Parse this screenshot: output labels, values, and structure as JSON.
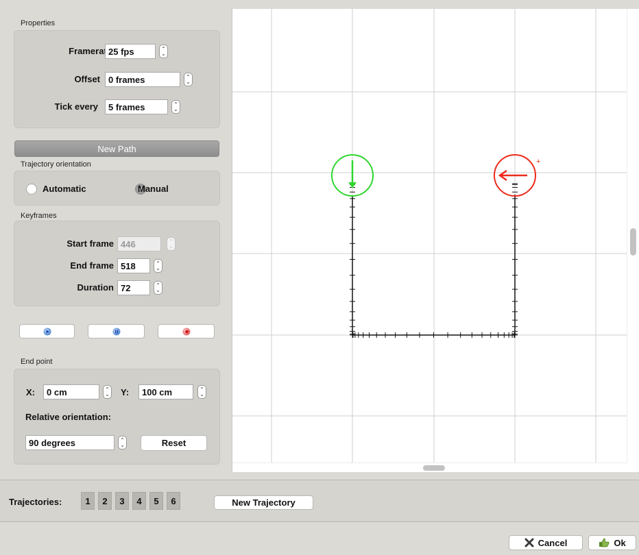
{
  "properties": {
    "title": "Properties",
    "framerate_label": "Framerate",
    "framerate_value": "25 fps",
    "offset_label": "Offset",
    "offset_value": "0 frames",
    "tick_label": "Tick every",
    "tick_value": "5 frames"
  },
  "new_path_label": "New Path",
  "orientation": {
    "title": "Trajectory orientation",
    "automatic_label": "Automatic",
    "manual_label": "Manual",
    "selected": "Manual"
  },
  "keyframes": {
    "title": "Keyframes",
    "start_label": "Start frame",
    "start_value": "446",
    "end_label": "End frame",
    "end_value": "518",
    "duration_label": "Duration",
    "duration_value": "72"
  },
  "endpoint": {
    "title": "End point",
    "x_label": "X:",
    "x_value": "0 cm",
    "y_label": "Y:",
    "y_value": "100 cm",
    "rel_label": "Relative orientation:",
    "rel_value": "90 degrees",
    "reset_label": "Reset"
  },
  "trajectories": {
    "label": "Trajectories:",
    "tabs": [
      "1",
      "2",
      "3",
      "4",
      "5",
      "6"
    ],
    "new_label": "New Trajectory"
  },
  "footer": {
    "cancel_label": "Cancel",
    "ok_label": "Ok"
  },
  "colors": {
    "start_marker": "#2fd62f",
    "end_marker": "#ee2a1b",
    "path": "#111111",
    "grid": "#cfcfcf"
  }
}
